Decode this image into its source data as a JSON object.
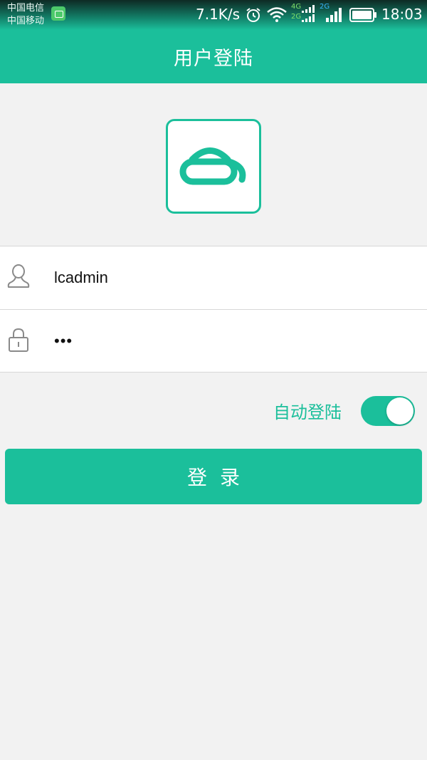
{
  "status_bar": {
    "carrier_1": "中国电信",
    "carrier_2": "中国移动",
    "net_speed": "7.1K/s",
    "signal_1_label": "4G",
    "signal_1_sub": "2G",
    "signal_2_label": "2G",
    "time": "18:03"
  },
  "header": {
    "title": "用户登陆"
  },
  "form": {
    "username_value": "lcadmin",
    "password_value": "•••"
  },
  "auto_login": {
    "label": "自动登陆",
    "enabled": true
  },
  "login_button": {
    "label": "登录"
  },
  "colors": {
    "accent": "#1bbf9b",
    "background": "#f2f2f2"
  },
  "icons": [
    "user-icon",
    "lock-icon",
    "alarm-icon",
    "wifi-icon",
    "signal-icon",
    "battery-icon",
    "app-logo-icon"
  ]
}
